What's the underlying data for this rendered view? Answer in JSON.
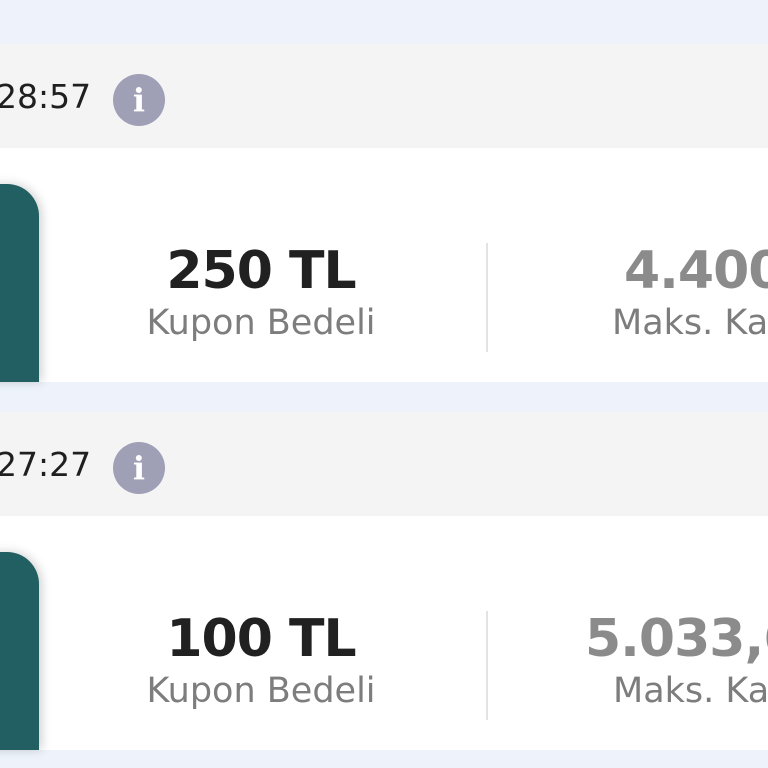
{
  "coupons": [
    {
      "time": "28:57",
      "amount": "250 TL",
      "amount_label": "Kupon Bedeli",
      "max_value": "4.400",
      "max_label": "Maks. Ka"
    },
    {
      "time": "27:27",
      "amount": "100 TL",
      "amount_label": "Kupon Bedeli",
      "max_value": "5.033,6",
      "max_label": "Maks. Ka"
    }
  ],
  "info_icon": "info-icon",
  "colors": {
    "background": "#eef3fb",
    "header_bg": "#f4f4f5",
    "card_teal": "#225f63",
    "info_gray": "#9f9fb6"
  }
}
